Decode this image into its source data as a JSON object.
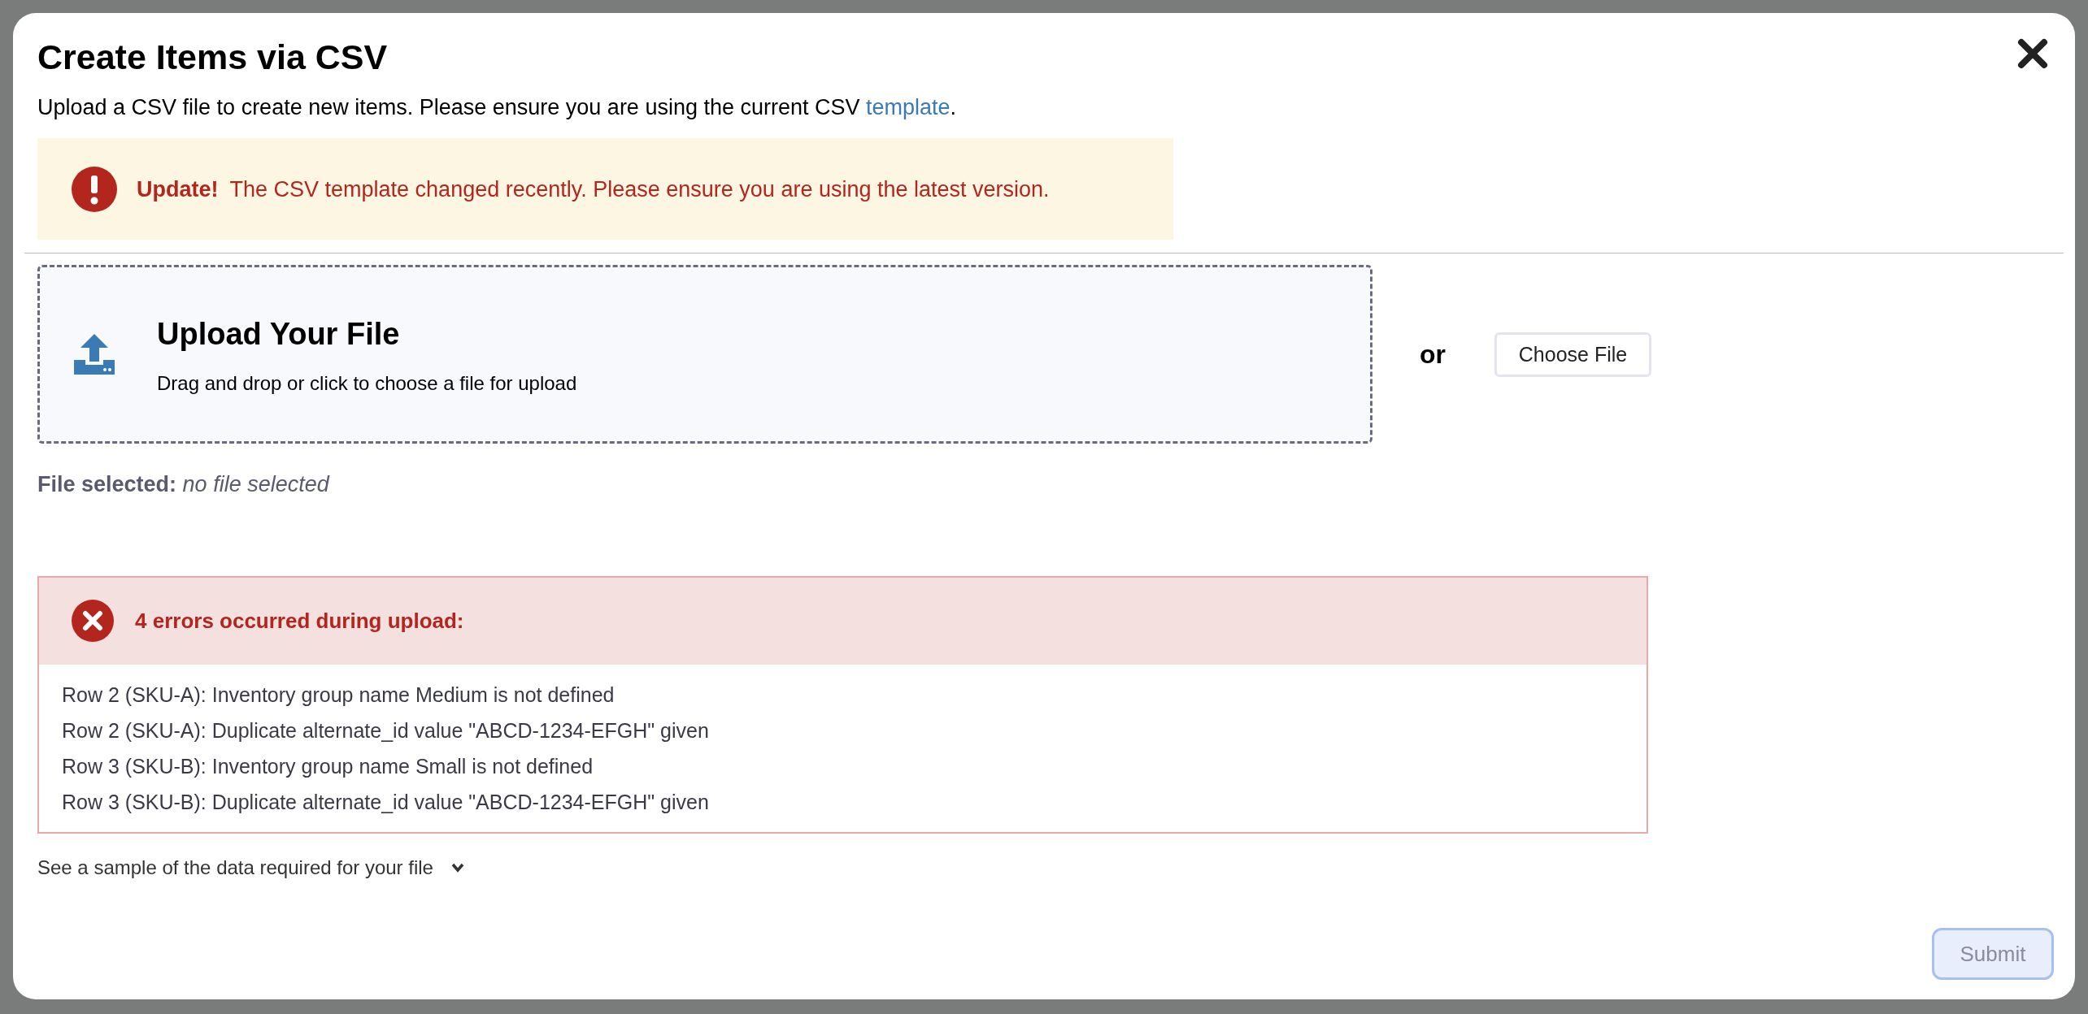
{
  "modal": {
    "title": "Create Items via CSV",
    "intro": "Upload a CSV file to create new items. Please ensure you are using the current CSV ",
    "intro_link": "template",
    "intro_end": ".",
    "notice": {
      "label": "Update!",
      "text": "The CSV template changed recently. Please ensure you are using the latest version."
    },
    "dropzone": {
      "title": "Upload Your File",
      "hint": "Drag and drop or click to choose a file for upload"
    },
    "or": "or",
    "choose_button": "Choose File",
    "file_selected": {
      "label": "File selected:",
      "value": "no file selected"
    },
    "errors": {
      "title": "4 errors occurred during upload:",
      "items": [
        "Row 2 (SKU-A): Inventory group name Medium is not defined",
        "Row 2 (SKU-A): Duplicate alternate_id value \"ABCD-1234-EFGH\" given",
        "Row 3 (SKU-B): Inventory group name Small is not defined",
        "Row 3 (SKU-B): Duplicate alternate_id value \"ABCD-1234-EFGH\" given"
      ]
    },
    "sample_toggle": {
      "label": "See a sample of the data required for your file",
      "expanded": false
    },
    "submit": {
      "label": "Submit",
      "disabled": true
    }
  }
}
